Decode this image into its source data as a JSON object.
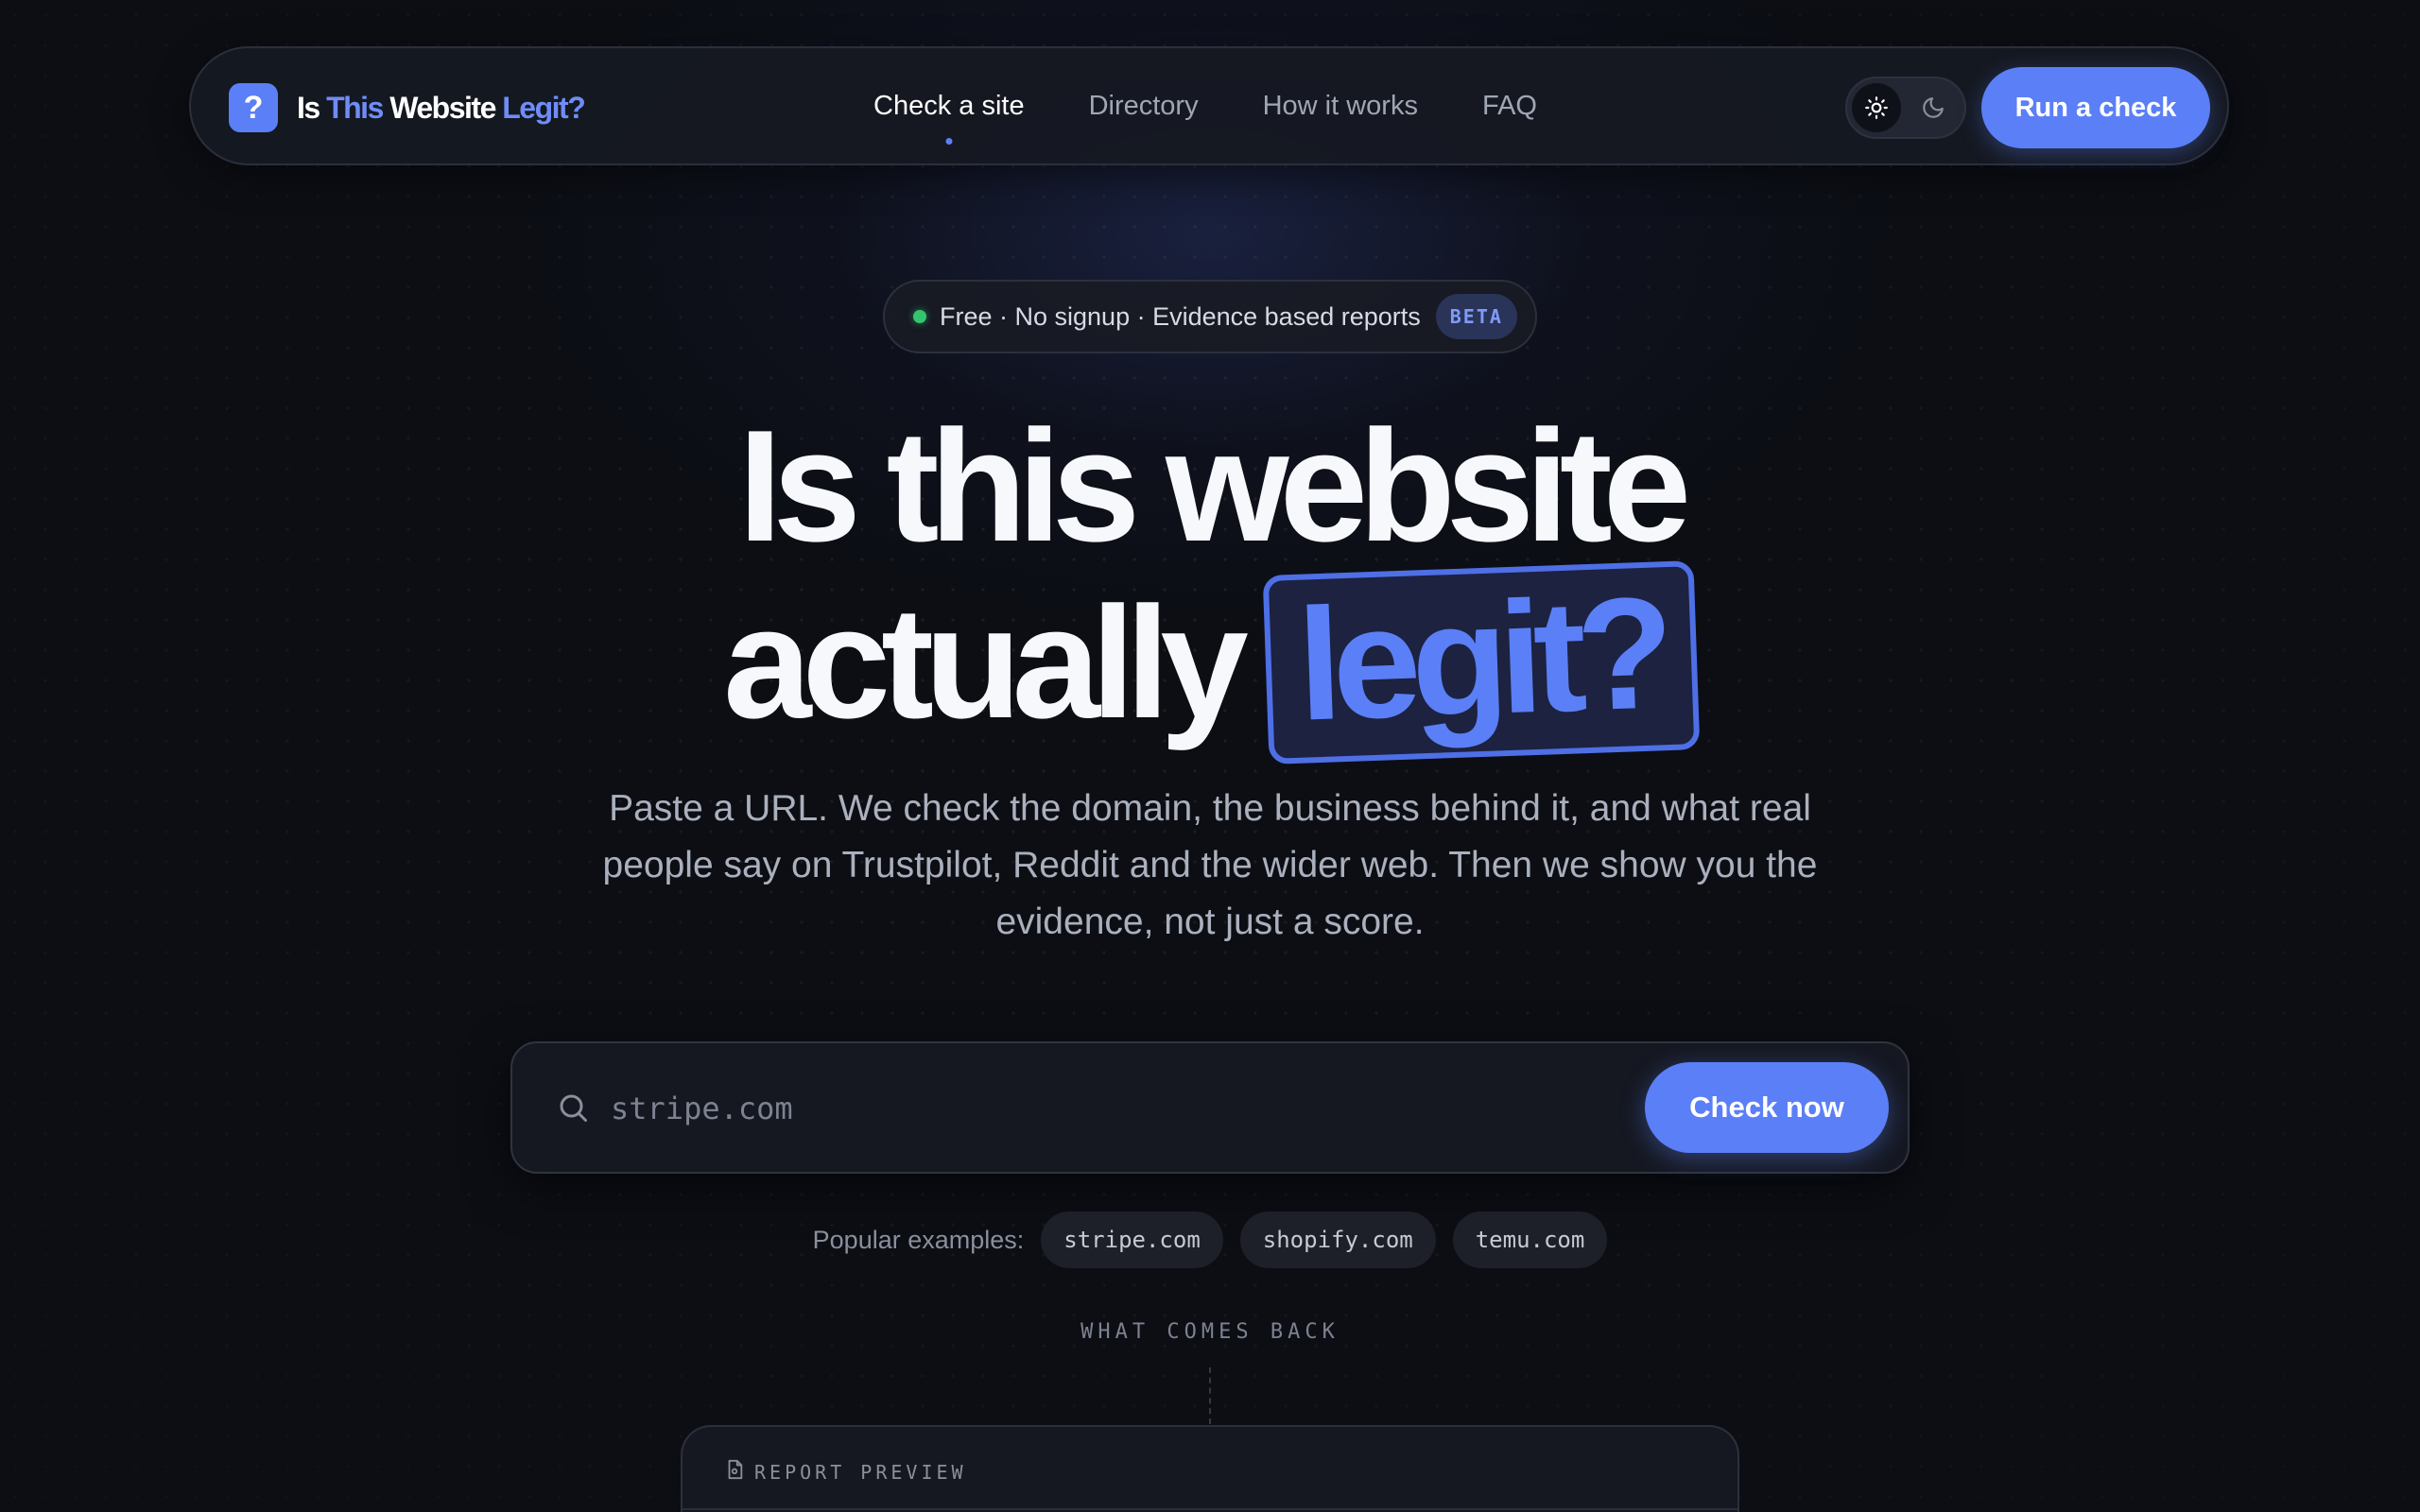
{
  "nav": {
    "logo_mark": "?",
    "logo_parts": {
      "is": "Is",
      "this": "This",
      "website": "Website",
      "legit": "Legit?"
    },
    "links": [
      {
        "label": "Check a site",
        "active": true
      },
      {
        "label": "Directory",
        "active": false
      },
      {
        "label": "How it works",
        "active": false
      },
      {
        "label": "FAQ",
        "active": false
      }
    ],
    "theme_options": [
      "sun-icon",
      "moon-icon"
    ],
    "cta_label": "Run a check"
  },
  "hero": {
    "badge_text": "Free · No signup · Evidence based reports",
    "badge_tag": "BETA",
    "headline_line1": "Is this website",
    "headline_line2_prefix": "actually",
    "headline_highlight": "legit?",
    "subtitle": "Paste a URL. We check the domain, the business behind it, and what real people say on Trustpilot, Reddit and the wider web. Then we show you the evidence, not just a score."
  },
  "search": {
    "placeholder": "stripe.com",
    "value": "",
    "button_label": "Check now"
  },
  "examples": {
    "label": "Popular examples:",
    "items": [
      "stripe.com",
      "shopify.com",
      "temu.com"
    ]
  },
  "section_label": "WHAT COMES BACK",
  "report_preview": {
    "title": "REPORT PREVIEW"
  },
  "colors": {
    "accent": "#5b7ff6",
    "background": "#0c0e14",
    "status_green": "#35c46e"
  }
}
